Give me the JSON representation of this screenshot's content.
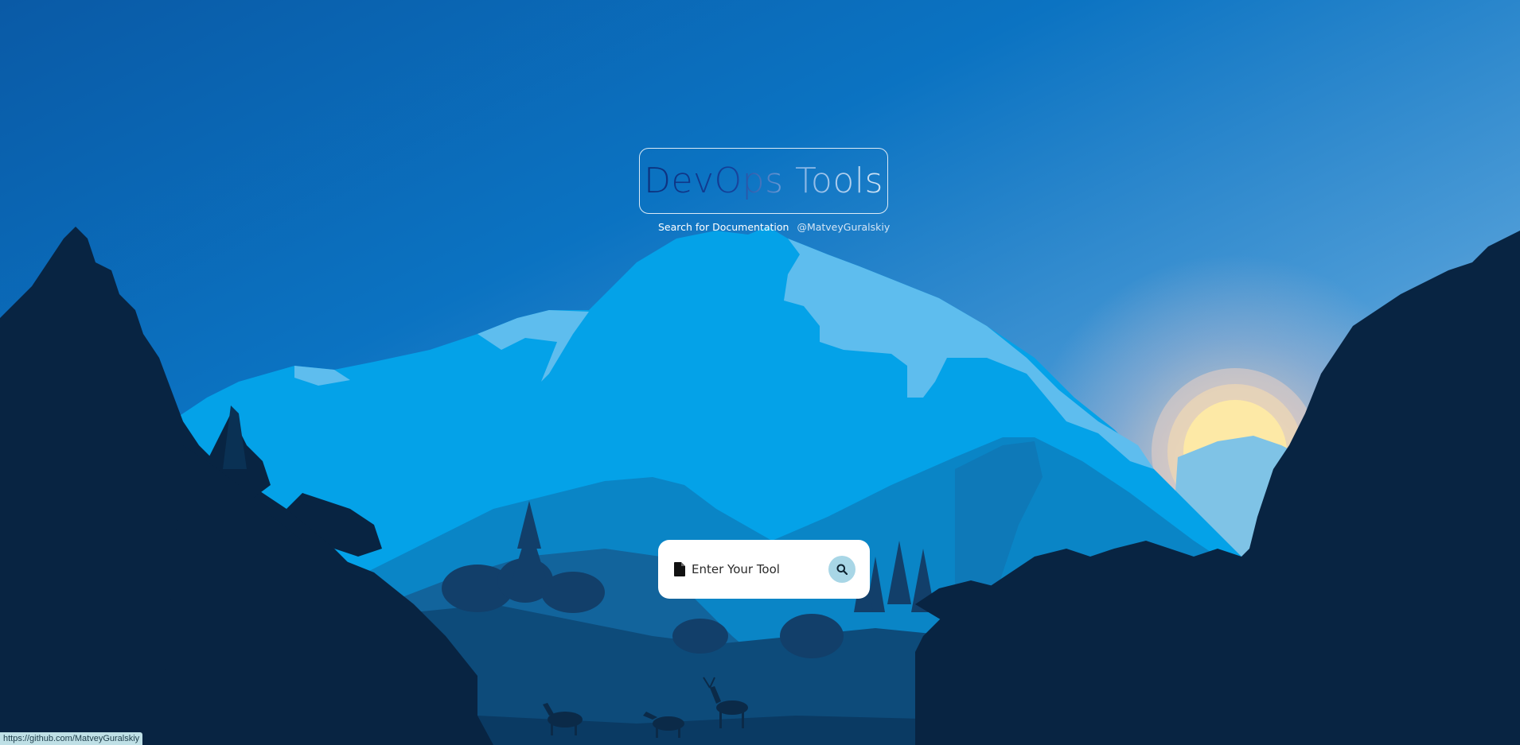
{
  "header": {
    "title": "DevOps Tools",
    "subtitle": "Search for Documentation",
    "author_link": "@MatveyGuralskiy"
  },
  "search": {
    "placeholder": "Enter Your Tool",
    "value": "",
    "leading_icon": "file-icon",
    "button_icon": "search-icon"
  },
  "status_bar": {
    "url": "https://github.com/MatveyGuralskiy"
  },
  "colors": {
    "sky_top": "#0a5ea8",
    "mountain": "#04a1e8",
    "forest": "#08233f",
    "sun": "#fde9a6",
    "search_button": "#a8d6e6"
  }
}
